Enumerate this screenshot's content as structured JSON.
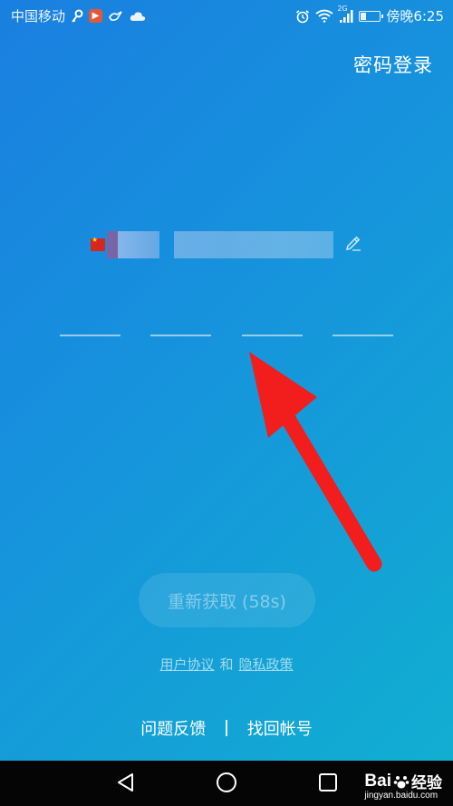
{
  "status_bar": {
    "carrier": "中国移动",
    "network": "2G",
    "time_label": "傍晚6:25",
    "battery_level": 0.3
  },
  "header": {
    "password_login_label": "密码登录"
  },
  "phone": {
    "flag_icon": "china-flag-icon",
    "edit_icon": "pencil-icon"
  },
  "code_input": {
    "slot_count": 4
  },
  "resend": {
    "label": "重新获取 (58s)"
  },
  "agreement": {
    "user_agreement": "用户协议",
    "and": "和",
    "privacy_policy": "隐私政策"
  },
  "footer": {
    "feedback": "问题反馈",
    "recover_account": "找回帐号"
  },
  "nav": {
    "back_icon": "triangle-back-icon",
    "home_icon": "circle-home-icon",
    "recent_icon": "square-recent-icon"
  },
  "watermark": {
    "brand": "Bai",
    "brand_suffix": "经验",
    "site": "jingyan.baidu.com"
  },
  "colors": {
    "gradient_start": "#1a7fe0",
    "gradient_end": "#11b0d0",
    "annotation_arrow": "#f21d1d"
  }
}
